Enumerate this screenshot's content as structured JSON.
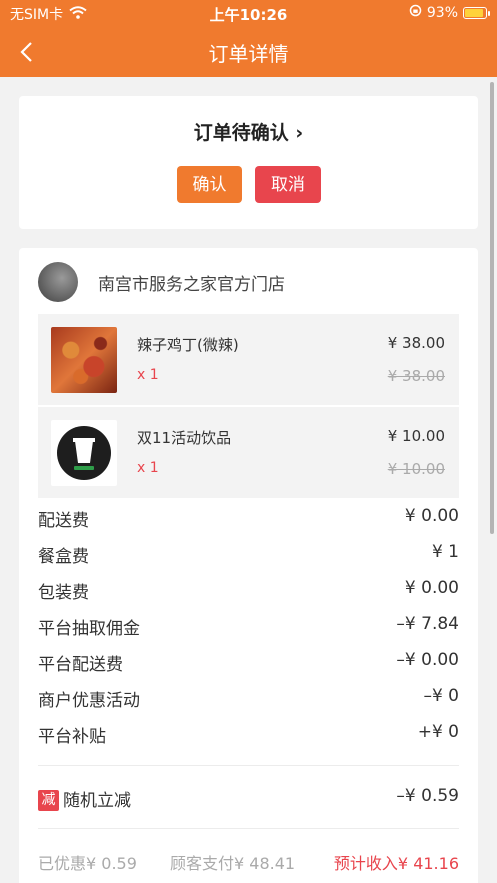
{
  "status_bar": {
    "carrier": "无SIM卡",
    "time": "上午10:26",
    "battery": "93%",
    "battery_level": 0.93
  },
  "nav": {
    "title": "订单详情"
  },
  "order_status": {
    "title": "订单待确认",
    "chevron": "›",
    "confirm_label": "确认",
    "cancel_label": "取消"
  },
  "shop": {
    "name": "南宫市服务之家官方门店"
  },
  "items": [
    {
      "name": "辣子鸡丁(微辣)",
      "qty": "x 1",
      "price": "¥ 38.00",
      "original_price": "¥ 38.00",
      "image": "spicy-chicken-photo"
    },
    {
      "name": "双11活动饮品",
      "qty": "x 1",
      "price": "¥ 10.00",
      "original_price": "¥ 10.00",
      "image": "drink-logo"
    }
  ],
  "fees": [
    {
      "label": "配送费",
      "value": "¥ 0.00"
    },
    {
      "label": "餐盒费",
      "value": "¥ 1"
    },
    {
      "label": "包装费",
      "value": "¥ 0.00"
    },
    {
      "label": "平台抽取佣金",
      "value": "–¥ 7.84"
    },
    {
      "label": "平台配送费",
      "value": "–¥ 0.00"
    },
    {
      "label": "商户优惠活动",
      "value": "–¥ 0"
    },
    {
      "label": "平台补贴",
      "value": "+¥ 0"
    }
  ],
  "discount": {
    "badge": "减",
    "label": "随机立减",
    "value": "–¥ 0.59"
  },
  "summary": {
    "discounted": "已优惠¥ 0.59",
    "customer_paid": "顾客支付¥ 48.41",
    "expected_income": "预计收入¥ 41.16"
  },
  "colors": {
    "brand": "#f07a2e",
    "danger": "#e8454d"
  }
}
